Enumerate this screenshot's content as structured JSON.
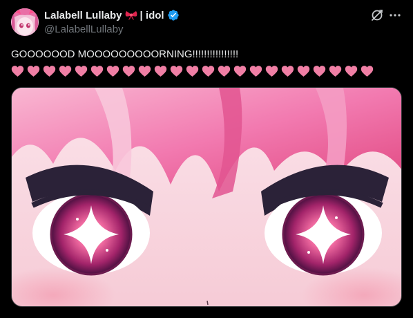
{
  "author": {
    "display_name": "Lalabell Lullaby",
    "name_suffix": "| idol",
    "handle": "@LalabellLullaby",
    "bow_icon": "ribbon-bow-icon",
    "verified_icon": "verified-badge-icon",
    "verified_color": "#1d9bf0",
    "avatar_icon": "avatar"
  },
  "header_actions": {
    "grok_icon": "grok-icon",
    "more_icon": "more-icon"
  },
  "tweet": {
    "text": "GOOOOOOD MOOOOOOOOORNING!!!!!!!!!!!!!!!!",
    "heart_count": 23,
    "heart_color": "#f07fa5"
  },
  "media": {
    "type": "image",
    "subject": "anime-eyes-closeup"
  },
  "colors": {
    "background": "#000000",
    "text_primary": "#e7e9ea",
    "text_secondary": "#71767b"
  }
}
